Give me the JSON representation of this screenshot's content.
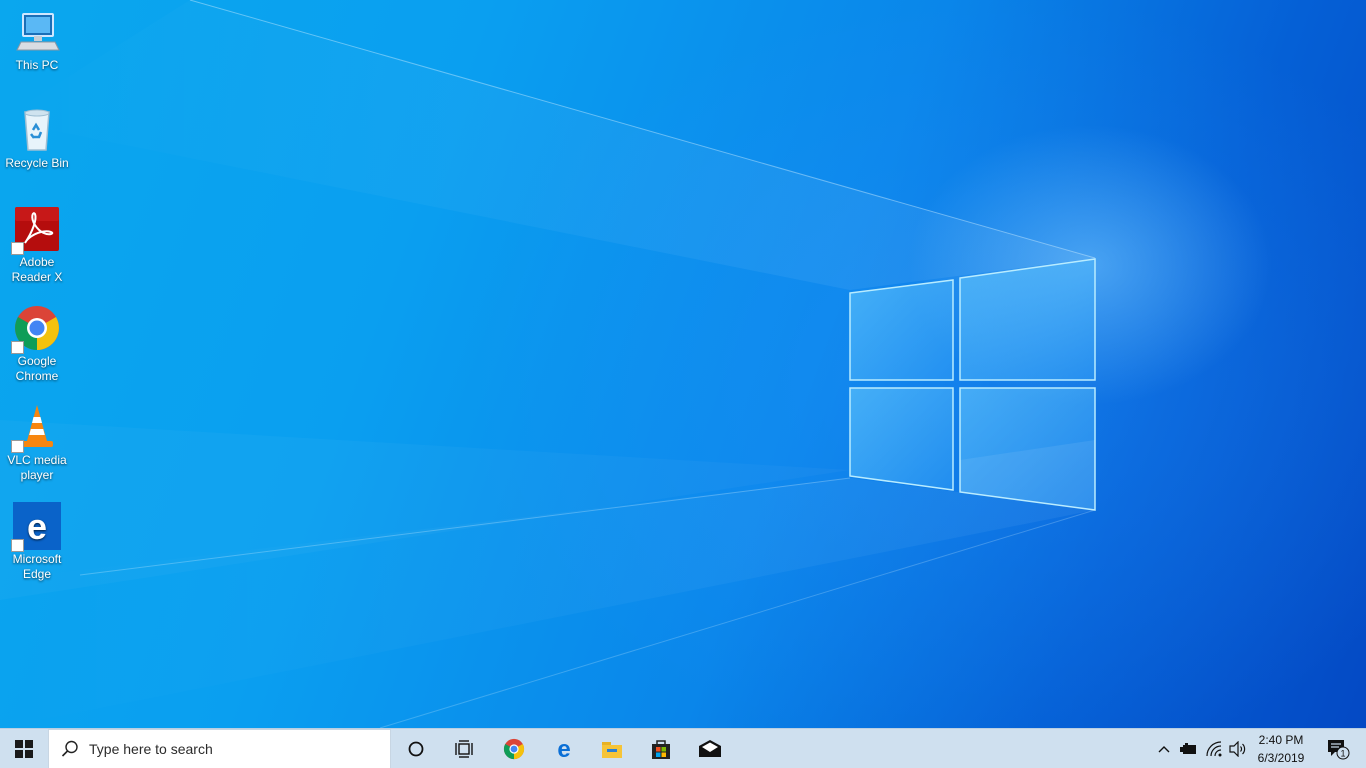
{
  "desktop": {
    "icons": [
      {
        "id": "this-pc",
        "label": "This PC"
      },
      {
        "id": "recycle-bin",
        "label": "Recycle Bin"
      },
      {
        "id": "adobe-reader",
        "label_lines": [
          "Adobe",
          "Reader X"
        ]
      },
      {
        "id": "google-chrome",
        "label_lines": [
          "Google",
          "Chrome"
        ]
      },
      {
        "id": "vlc",
        "label_lines": [
          "VLC media",
          "player"
        ]
      },
      {
        "id": "edge",
        "label_lines": [
          "Microsoft",
          "Edge"
        ]
      }
    ]
  },
  "taskbar": {
    "search_placeholder": "Type here to search",
    "pinned": [
      "cortana-icon",
      "task-view-icon",
      "chrome-icon",
      "edge-icon",
      "file-explorer-icon",
      "store-icon",
      "mail-icon"
    ],
    "clock_time": "2:40 PM",
    "clock_date": "6/3/2019",
    "notification_count": "1"
  },
  "colors": {
    "accent": "#0078d7",
    "taskbar_bg": "#cfe0ef"
  }
}
